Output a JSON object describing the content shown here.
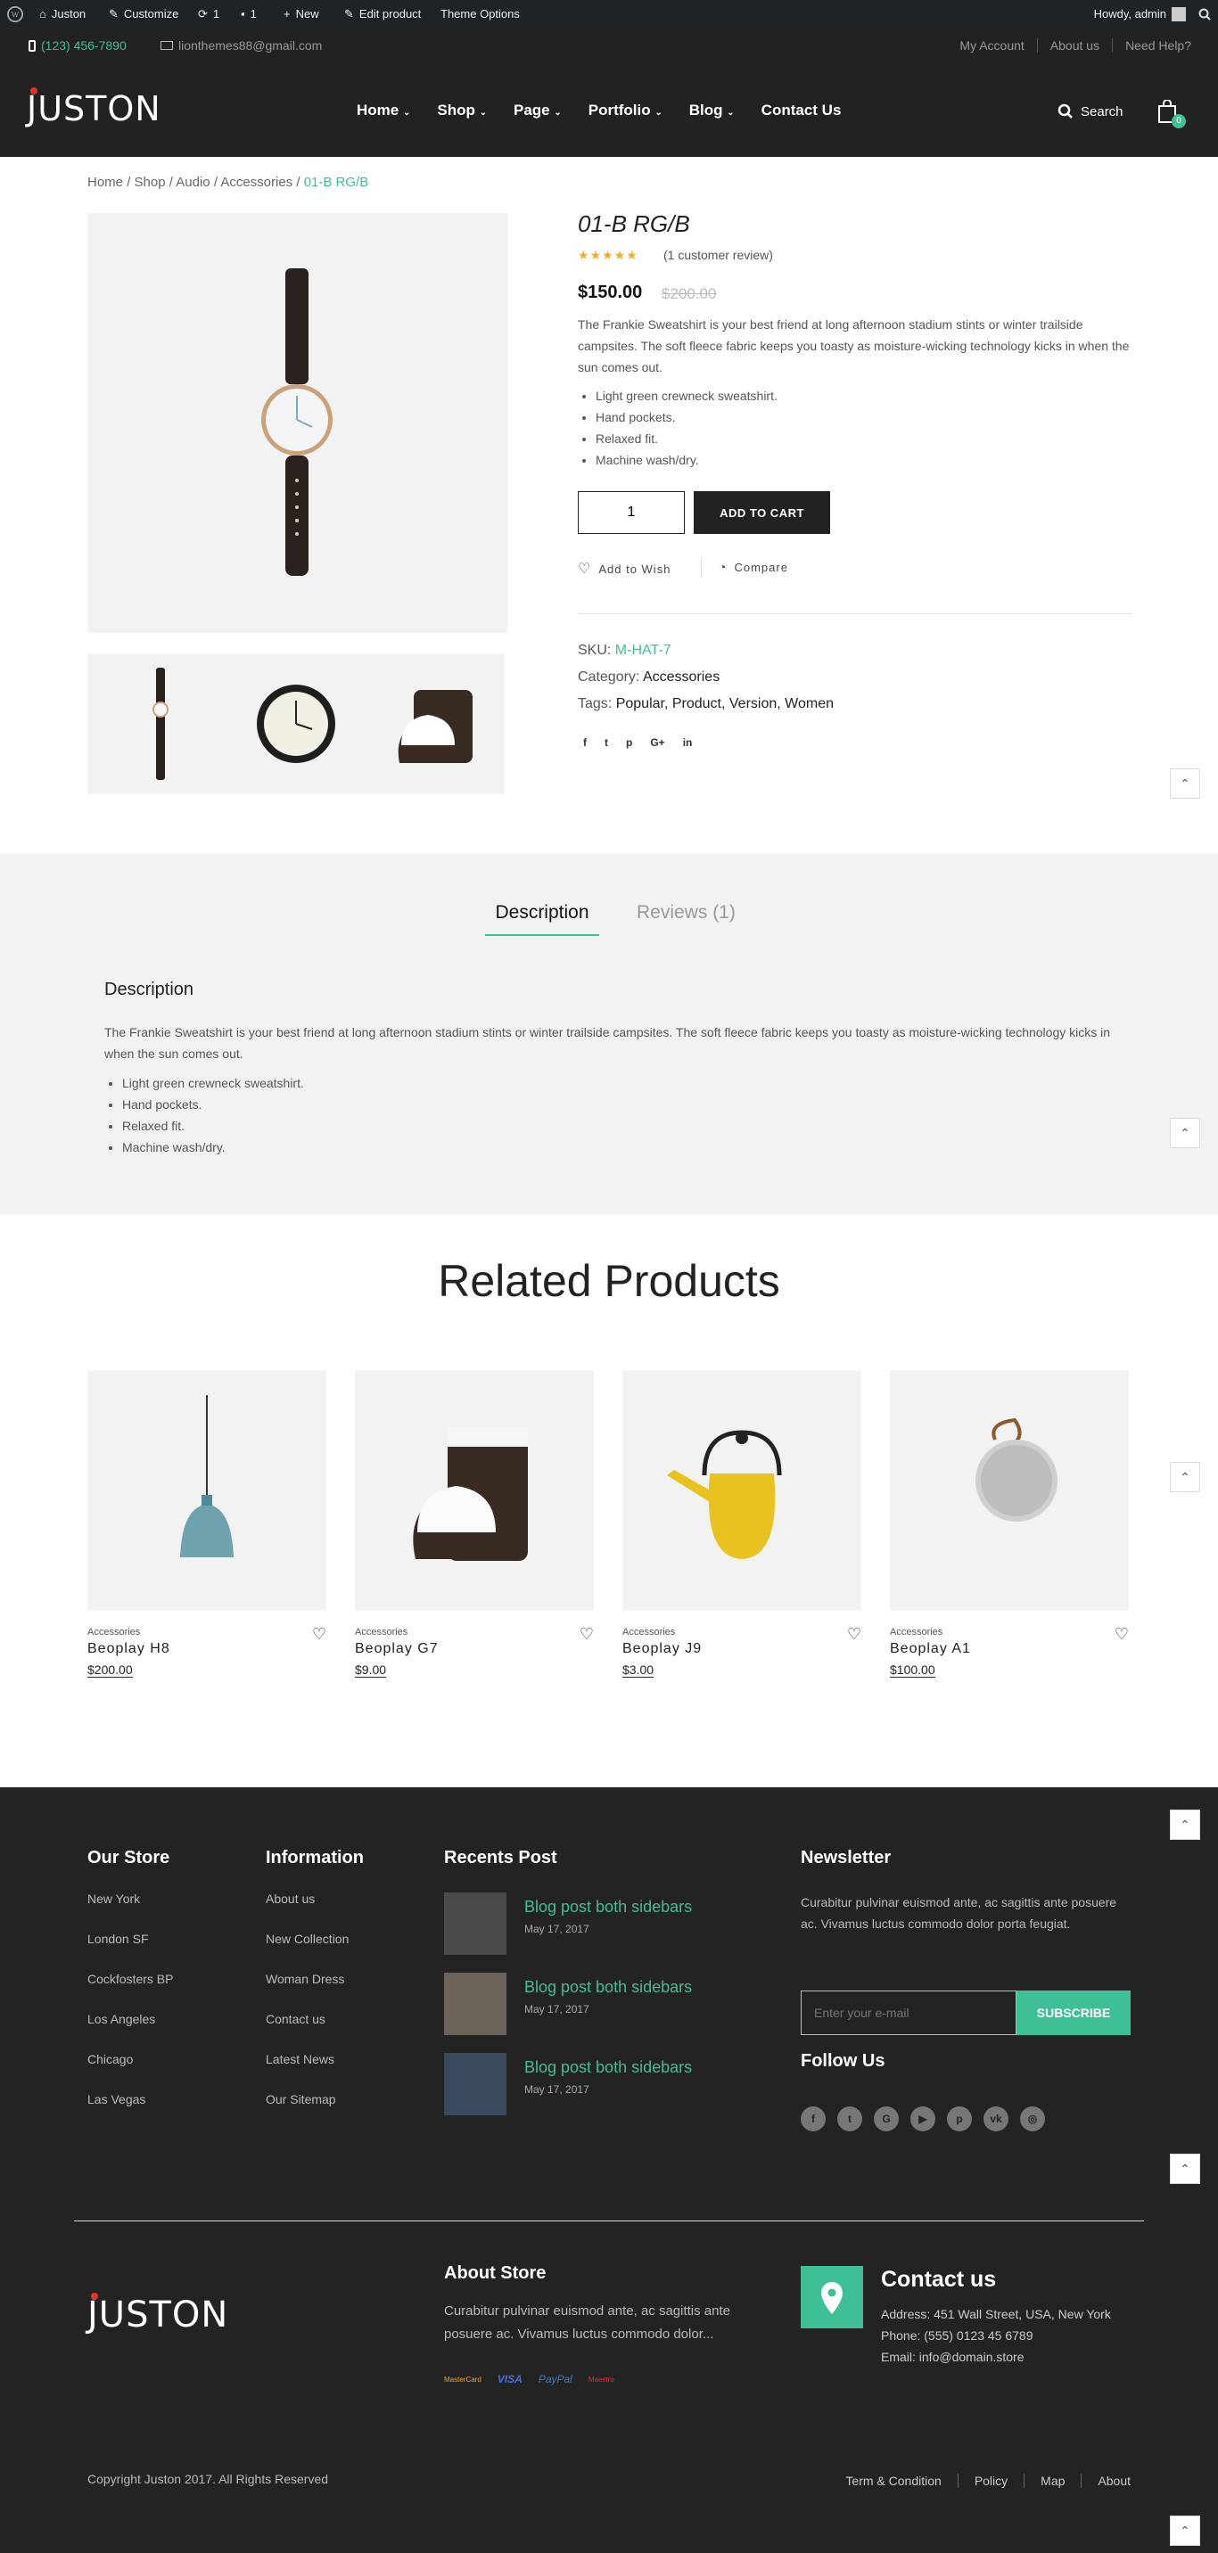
{
  "admin_bar": {
    "site": "Juston",
    "customize": "Customize",
    "updates": "1",
    "comments": "1",
    "new": "New",
    "edit": "Edit product",
    "theme": "Theme Options",
    "howdy": "Howdy, admin"
  },
  "topbar": {
    "phone": "(123) 456-7890",
    "email": "lionthemes88@gmail.com",
    "links": [
      "My Account",
      "About us",
      "Need Help?"
    ]
  },
  "header": {
    "logo": "JUSTON",
    "nav": [
      "Home",
      "Shop",
      "Page",
      "Portfolio",
      "Blog",
      "Contact Us"
    ],
    "search": "Search",
    "cart_count": "0"
  },
  "breadcrumb": {
    "items": [
      "Home",
      "Shop",
      "Audio",
      "Accessories"
    ],
    "current": "01-B RG/B",
    "sep": "/"
  },
  "product": {
    "title": "01-B RG/B",
    "rating": "★★★★★",
    "reviews": "(1 customer review)",
    "price": "$150.00",
    "old_price": "$200.00",
    "description": "The Frankie Sweatshirt is your best friend at long afternoon stadium stints or winter trailside campsites. The soft fleece fabric keeps you toasty as moisture-wicking technology kicks in when the sun comes out.",
    "features": [
      "Light green crewneck sweatshirt.",
      "Hand pockets.",
      "Relaxed fit.",
      "Machine wash/dry."
    ],
    "qty": "1",
    "add_to_cart": "ADD TO CART",
    "wish": "Add to Wish",
    "compare": "Compare",
    "sku_label": "SKU:",
    "sku": "M-HAT-7",
    "category_label": "Category:",
    "category": "Accessories",
    "tags_label": "Tags:",
    "tags": "Popular, Product, Version, Women",
    "share": [
      "f",
      "t",
      "p",
      "G+",
      "in"
    ]
  },
  "tabs": {
    "items": [
      "Description",
      "Reviews (1)"
    ],
    "heading": "Description",
    "text": "The Frankie Sweatshirt is your best friend at long afternoon stadium stints or winter trailside campsites. The soft fleece fabric keeps you toasty as moisture-wicking technology kicks in when the sun comes out.",
    "features": [
      "Light green crewneck sweatshirt.",
      "Hand pockets.",
      "Relaxed fit.",
      "Machine wash/dry."
    ]
  },
  "related": {
    "title": "Related Products",
    "items": [
      {
        "cat": "Accessories",
        "name": "Beoplay H8",
        "price": "$200.00"
      },
      {
        "cat": "Accessories",
        "name": "Beoplay G7",
        "price": "$9.00"
      },
      {
        "cat": "Accessories",
        "name": "Beoplay J9",
        "price": "$3.00"
      },
      {
        "cat": "Accessories",
        "name": "Beoplay A1",
        "price": "$100.00"
      }
    ]
  },
  "footer": {
    "store_title": "Our Store",
    "store": [
      "New York",
      "London SF",
      "Cockfosters BP",
      "Los Angeles",
      "Chicago",
      "Las Vegas"
    ],
    "info_title": "Information",
    "info": [
      "About us",
      "New Collection",
      "Woman Dress",
      "Contact us",
      "Latest News",
      "Our Sitemap"
    ],
    "posts_title": "Recents Post",
    "posts": [
      {
        "title": "Blog post both sidebars",
        "date": "May 17, 2017"
      },
      {
        "title": "Blog post both sidebars",
        "date": "May 17, 2017"
      },
      {
        "title": "Blog post both sidebars",
        "date": "May 17, 2017"
      }
    ],
    "news_title": "Newsletter",
    "news_text": "Curabitur pulvinar euismod ante, ac sagittis ante posuere ac. Vivamus luctus commodo dolor porta feugiat.",
    "email_placeholder": "Enter your e-mail",
    "subscribe": "SUBSCRIBE",
    "follow": "Follow Us",
    "logo": "JUSTON",
    "about_title": "About Store",
    "about_text": "Curabitur pulvinar euismod ante, ac sagittis ante posuere ac. Vivamus luctus commodo dolor...",
    "payments": [
      "MasterCard",
      "VISA",
      "PayPal",
      "Maestro"
    ],
    "contact_title": "Contact us",
    "address": "Address: 451 Wall Street, USA, New York",
    "phone": "Phone: (555) 0123 45 6789",
    "email": "Email: info@domain.store",
    "copyright": "Copyright Juston 2017. All Rights Reserved",
    "links": [
      "Term & Condition",
      "Policy",
      "Map",
      "About"
    ]
  },
  "colors": {
    "accent": "#3fbf97",
    "dark": "#222222",
    "footer": "#232323",
    "star": "#f2b01e"
  }
}
